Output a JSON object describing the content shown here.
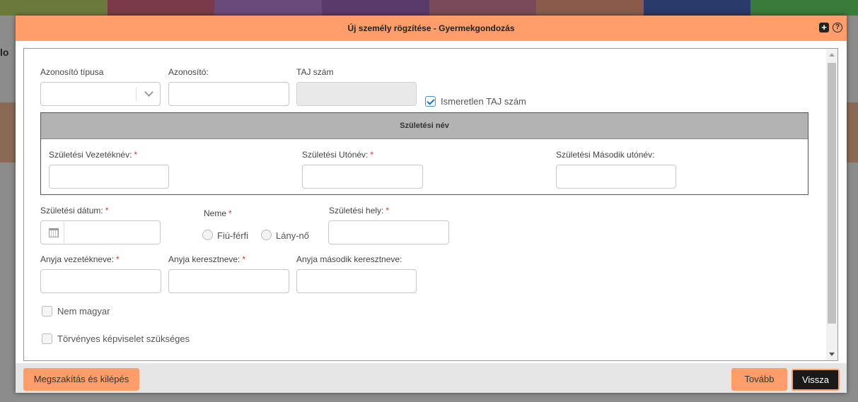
{
  "dialog": {
    "title": "Új személy rögzítése - Gyermekgondozás"
  },
  "form": {
    "id_type": {
      "label": "Azonosító típusa",
      "value": ""
    },
    "id_number": {
      "label": "Azonosító:",
      "value": ""
    },
    "taj": {
      "label": "TAJ szám",
      "value": ""
    },
    "unknown_taj": {
      "label": "Ismeretlen TAJ szám",
      "checked": true
    },
    "birth_name_section": {
      "title": "Születési név",
      "surname": {
        "label": "Születési Vezetéknév:",
        "required_mark": "*",
        "value": ""
      },
      "given_name": {
        "label": "Születési Utónév:",
        "required_mark": "*",
        "value": ""
      },
      "second_given_name": {
        "label": "Születési Második utónév:",
        "value": ""
      }
    },
    "birth_date": {
      "label": "Születési dátum:",
      "required_mark": "*",
      "value": ""
    },
    "gender": {
      "label": "Neme",
      "required_mark": "*",
      "options": [
        "Fiú-férfi",
        "Lány-nő"
      ],
      "selected": null
    },
    "birth_place": {
      "label": "Születési hely:",
      "required_mark": "*",
      "value": ""
    },
    "mother_surname": {
      "label": "Anyja vezetékneve:",
      "required_mark": "*",
      "value": ""
    },
    "mother_given_name": {
      "label": "Anyja keresztneve:",
      "required_mark": "*",
      "value": ""
    },
    "mother_second_given_name": {
      "label": "Anyja második keresztneve:",
      "value": ""
    },
    "not_hungarian": {
      "label": "Nem magyar",
      "checked": false
    },
    "legal_representation": {
      "label": "Törvényes képviselet szükséges",
      "checked": false
    }
  },
  "footer": {
    "cancel_label": "Megszakítás és kilépés",
    "next_label": "Tovább",
    "back_label": "Vissza"
  },
  "colors": {
    "accent": "#ff9e6a",
    "required": "#e03030",
    "section_header": "#b3b3b3"
  }
}
